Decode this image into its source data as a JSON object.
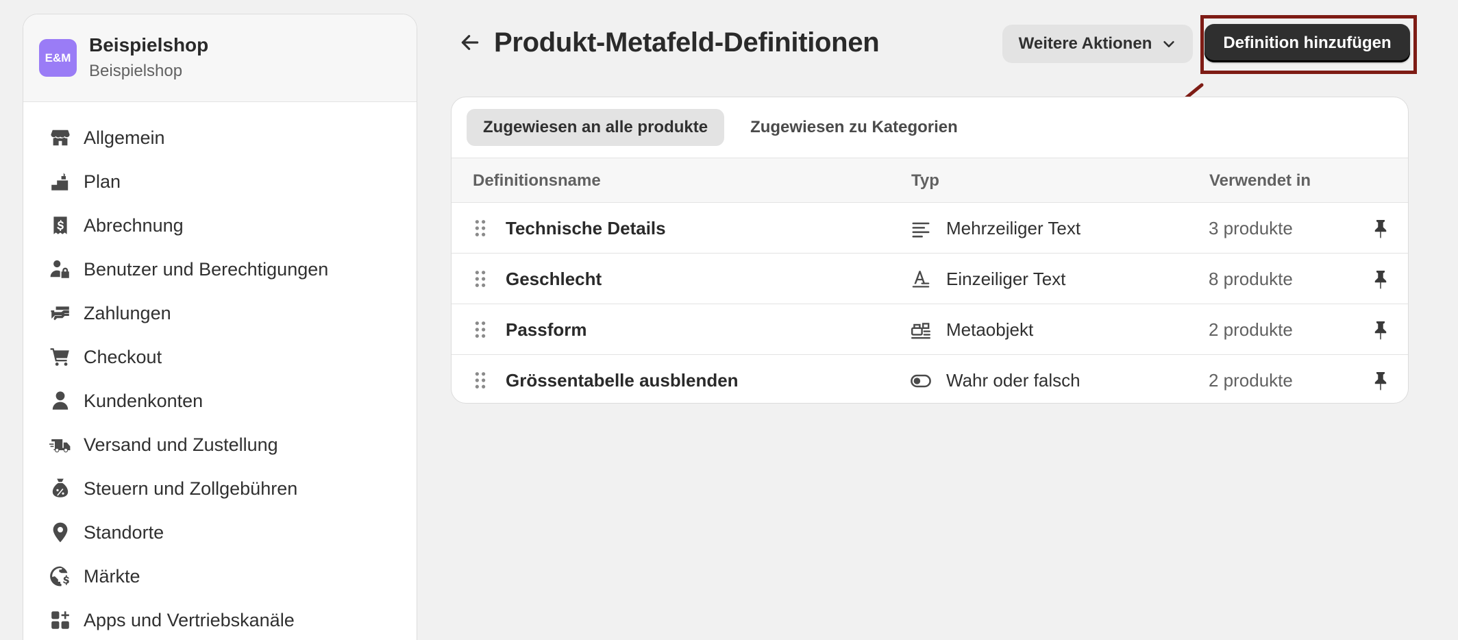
{
  "store": {
    "avatar_text": "E&M",
    "avatar_color": "#9a7cf6",
    "name": "Beispielshop",
    "subtitle": "Beispielshop"
  },
  "sidebar": {
    "items": [
      {
        "label": "Allgemein",
        "icon": "store-icon"
      },
      {
        "label": "Plan",
        "icon": "plan-icon"
      },
      {
        "label": "Abrechnung",
        "icon": "billing-icon"
      },
      {
        "label": "Benutzer und Berechtigungen",
        "icon": "users-lock-icon"
      },
      {
        "label": "Zahlungen",
        "icon": "payments-icon"
      },
      {
        "label": "Checkout",
        "icon": "cart-icon"
      },
      {
        "label": "Kundenkonten",
        "icon": "person-icon"
      },
      {
        "label": "Versand und Zustellung",
        "icon": "truck-icon"
      },
      {
        "label": "Steuern und Zollgebühren",
        "icon": "tax-bag-icon"
      },
      {
        "label": "Standorte",
        "icon": "location-icon"
      },
      {
        "label": "Märkte",
        "icon": "globe-icon"
      },
      {
        "label": "Apps und Vertriebskanäle",
        "icon": "apps-icon"
      }
    ]
  },
  "header": {
    "title": "Produkt-Metafeld-Definitionen",
    "more_actions_label": "Weitere Aktionen",
    "primary_button_label": "Definition hinzufügen",
    "annotation_color": "#7e1c15"
  },
  "tabs": [
    {
      "label": "Zugewiesen an alle produkte",
      "active": true
    },
    {
      "label": "Zugewiesen zu Kategorien",
      "active": false
    }
  ],
  "table": {
    "columns": [
      "Definitionsname",
      "Typ",
      "Verwendet in"
    ],
    "rows": [
      {
        "name": "Technische Details",
        "type": "Mehrzeiliger Text",
        "type_icon": "multiline-text-icon",
        "used_in": "3 produkte"
      },
      {
        "name": "Geschlecht",
        "type": "Einzeiliger Text",
        "type_icon": "single-line-text-icon",
        "used_in": "8 produkte"
      },
      {
        "name": "Passform",
        "type": "Metaobjekt",
        "type_icon": "metaobject-icon",
        "used_in": "2 produkte"
      },
      {
        "name": "Grössentabelle ausblenden",
        "type": "Wahr oder falsch",
        "type_icon": "toggle-icon",
        "used_in": "2 produkte"
      }
    ]
  }
}
